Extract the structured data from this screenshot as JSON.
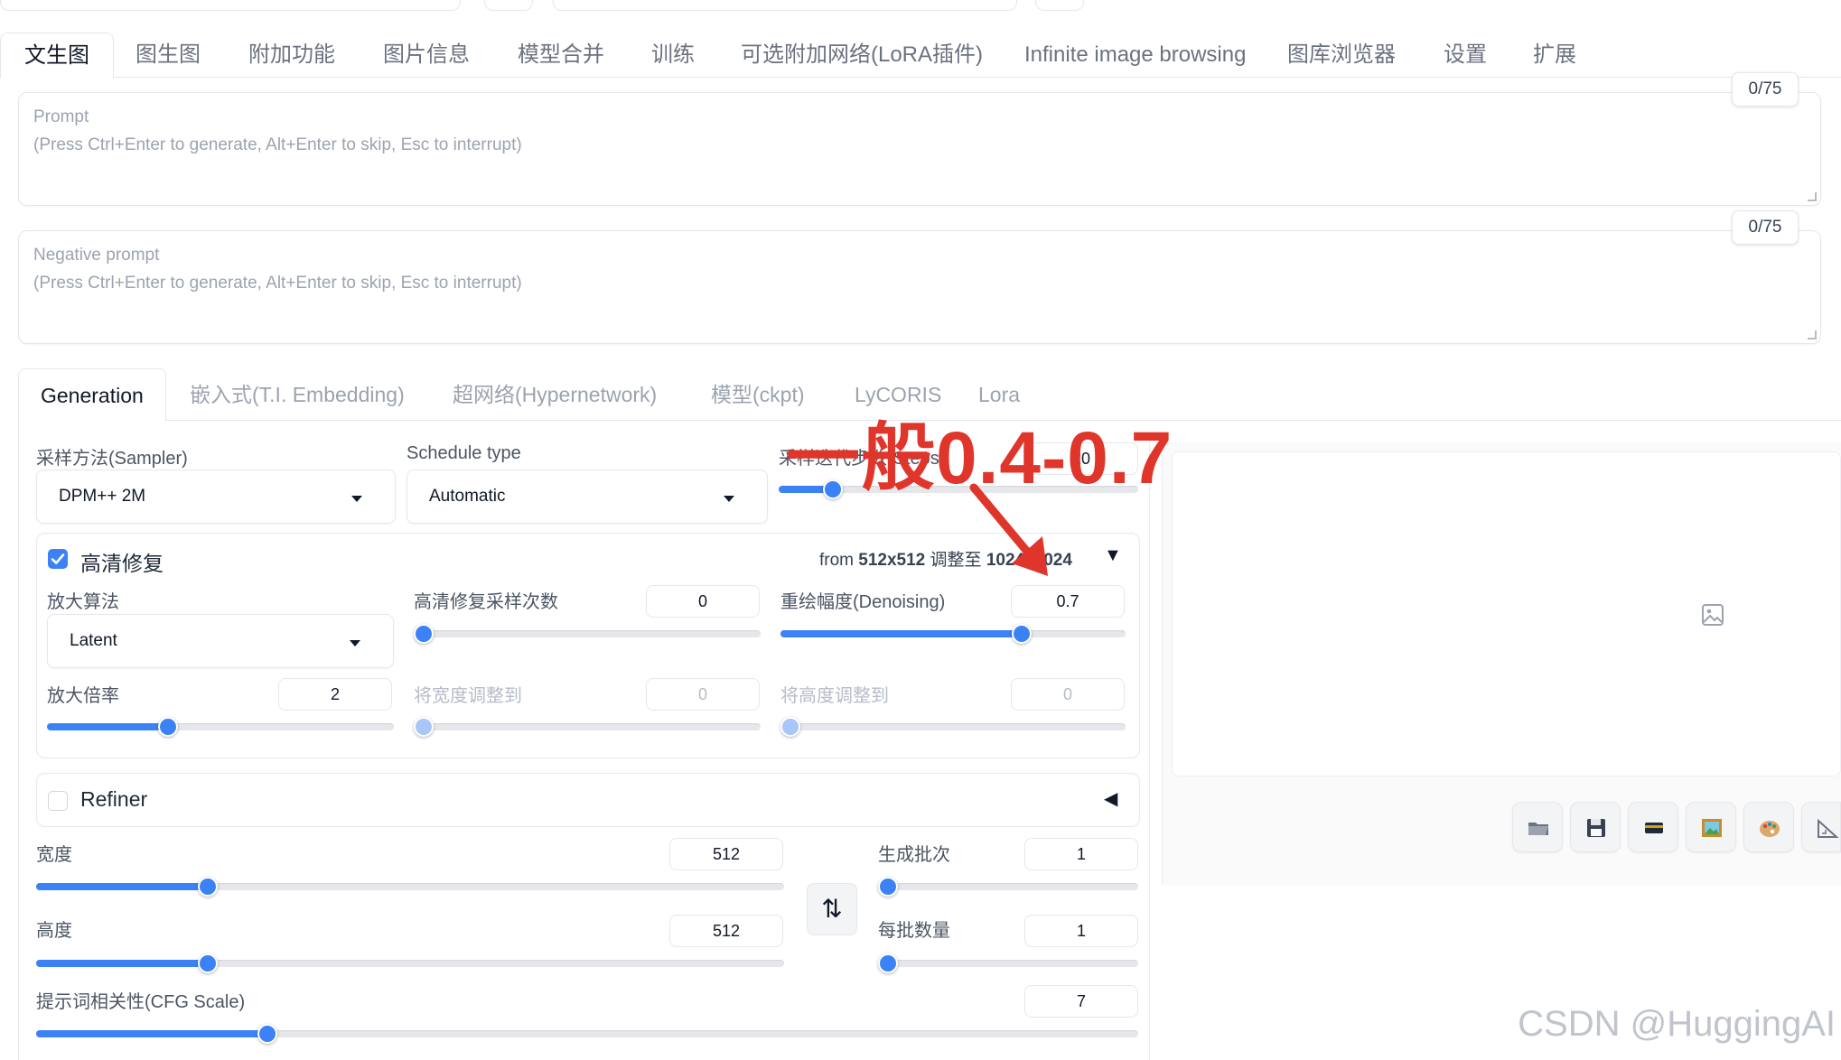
{
  "main_tabs": [
    "文生图",
    "图生图",
    "附加功能",
    "图片信息",
    "模型合并",
    "训练",
    "可选附加网络(LoRA插件)",
    "Infinite image browsing",
    "图库浏览器",
    "设置",
    "扩展"
  ],
  "prompt": {
    "label": "Prompt",
    "hint": "(Press Ctrl+Enter to generate, Alt+Enter to skip, Esc to interrupt)",
    "counter": "0/75"
  },
  "negative_prompt": {
    "label": "Negative prompt",
    "hint": "(Press Ctrl+Enter to generate, Alt+Enter to skip, Esc to interrupt)",
    "counter": "0/75"
  },
  "sub_tabs": [
    "Generation",
    "嵌入式(T.I. Embedding)",
    "超网络(Hypernetwork)",
    "模型(ckpt)",
    "LyCORIS",
    "Lora"
  ],
  "sampler": {
    "label": "采样方法(Sampler)",
    "value": "DPM++ 2M"
  },
  "schedule": {
    "label": "Schedule type",
    "value": "Automatic"
  },
  "steps": {
    "label": "采样迭代步数(Steps)",
    "value": "20",
    "level": 0.15
  },
  "hires": {
    "label": "高清修复",
    "checked": true,
    "from_prefix": "from",
    "from_size": "512x512",
    "resize_label": "调整至",
    "to_size": "1024x1024",
    "collapse_glyph": "▼",
    "upscaler": {
      "label": "放大算法",
      "value": "Latent"
    },
    "hires_steps": {
      "label": "高清修复采样次数",
      "value": "0",
      "level": 0.0
    },
    "denoising": {
      "label": "重绘幅度(Denoising)",
      "value": "0.7",
      "level": 0.7
    },
    "upscale_by": {
      "label": "放大倍率",
      "value": "2",
      "level": 0.35
    },
    "resize_width": {
      "label": "将宽度调整到",
      "value": "0",
      "level": 0.0
    },
    "resize_height": {
      "label": "将高度调整到",
      "value": "0",
      "level": 0.0
    }
  },
  "refiner": {
    "label": "Refiner",
    "checked": false,
    "collapse_glyph": "◀"
  },
  "width": {
    "label": "宽度",
    "value": "512",
    "level": 0.23
  },
  "height": {
    "label": "高度",
    "value": "512",
    "level": 0.23
  },
  "batch_count": {
    "label": "生成批次",
    "value": "1",
    "level": 0.0
  },
  "batch_size": {
    "label": "每批数量",
    "value": "1",
    "level": 0.0
  },
  "cfg": {
    "label": "提示词相关性(CFG Scale)",
    "value": "7",
    "level": 0.21
  },
  "swap_glyph": "⇅",
  "annotation": "一般0.4-0.7",
  "watermark": "CSDN @HuggingAI",
  "colors": {
    "accent": "#3b82f6",
    "annotation": "#e0352b"
  },
  "output_icons": [
    "folder-icon",
    "save-icon",
    "zip-icon",
    "send-to-img2img-icon",
    "send-to-inpaint-icon",
    "send-to-extras-icon"
  ]
}
